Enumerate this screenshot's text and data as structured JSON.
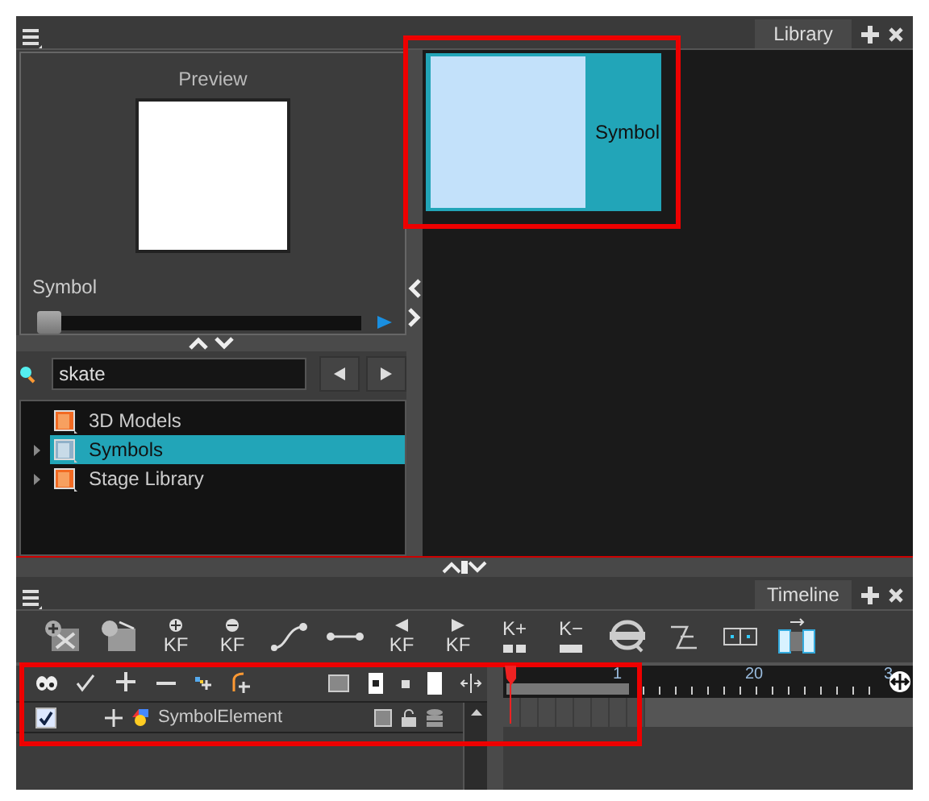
{
  "library_panel": {
    "tab": "Library"
  },
  "preview": {
    "title": "Preview",
    "caption": "Symbol",
    "slider": {
      "level": 0
    }
  },
  "search": {
    "value": "skate"
  },
  "tree": [
    {
      "label": "3D Models",
      "expandable": false,
      "selected": false
    },
    {
      "label": "Symbols",
      "expandable": true,
      "selected": true
    },
    {
      "label": "Stage Library",
      "expandable": true,
      "selected": false
    }
  ],
  "symbol_thumbnail": {
    "label": "Symbol"
  },
  "timeline": {
    "tab": "Timeline",
    "toolbar": [
      {
        "kind": "icon"
      },
      {
        "kind": "icon"
      },
      {
        "kind": "kf",
        "label": "KF"
      },
      {
        "kind": "kf",
        "label": "KF"
      },
      {
        "kind": "icon"
      },
      {
        "kind": "icon"
      },
      {
        "kind": "kf",
        "label": "KF"
      },
      {
        "kind": "kf",
        "label": "KF"
      },
      {
        "kind": "k",
        "label": "K+"
      },
      {
        "kind": "k",
        "label": "K−"
      },
      {
        "kind": "icon"
      },
      {
        "kind": "icon"
      },
      {
        "kind": "icon"
      },
      {
        "kind": "icon"
      }
    ],
    "layers": [
      {
        "name": "SymbolElement",
        "enabled": true
      }
    ],
    "ruler": [
      "1",
      "20",
      "3"
    ]
  }
}
